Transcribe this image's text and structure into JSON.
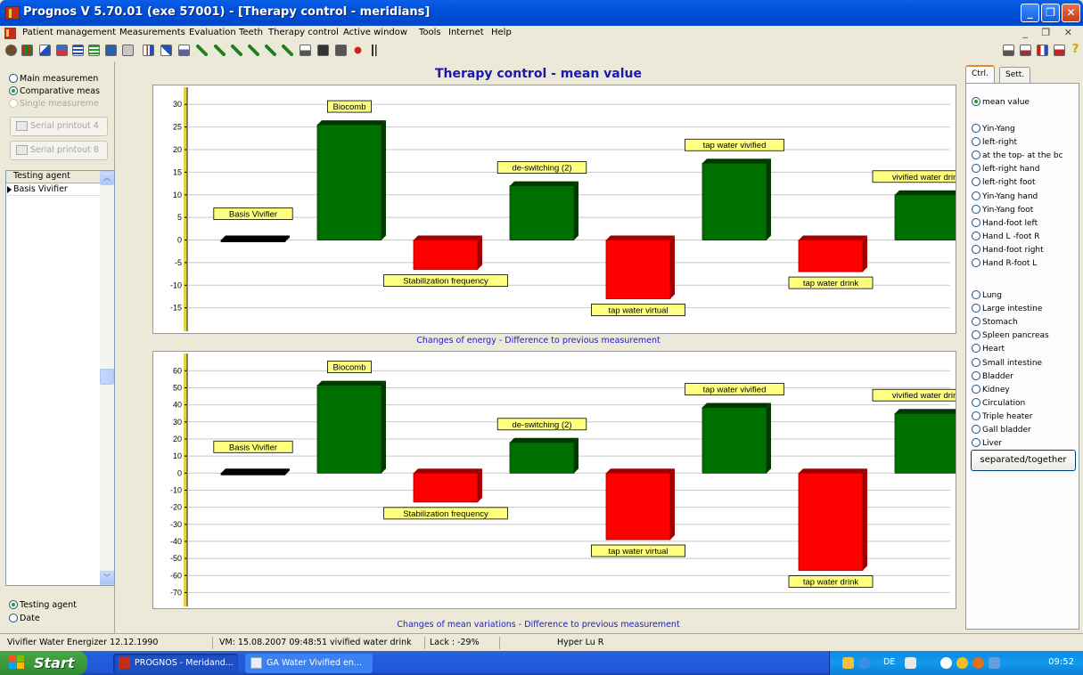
{
  "window": {
    "title": "Prognos V 5.70.01  (exe 57001) - [Therapy control - meridians]",
    "controls": [
      "minimize",
      "maximize",
      "close"
    ]
  },
  "menu": {
    "items": [
      "Patient management",
      "Measurements",
      "Evaluation",
      "Teeth",
      "Therapy control",
      "Active window",
      "Tools",
      "Internet",
      "Help"
    ]
  },
  "left_panel": {
    "view_options": [
      {
        "label": "Main measuremen",
        "selected": false,
        "enabled": true
      },
      {
        "label": "Comparative meas",
        "selected": true,
        "enabled": true
      },
      {
        "label": "Single measureme",
        "selected": false,
        "enabled": false
      }
    ],
    "buttons": [
      {
        "label": "Serial printout 4",
        "icon": "printer-icon",
        "enabled": false
      },
      {
        "label": "Serial printout 8",
        "icon": "printer-icon",
        "enabled": false
      }
    ],
    "list": {
      "header": "Testing agent",
      "rows": [
        "Basis Vivifier"
      ]
    },
    "sort_options": [
      {
        "label": "Testing agent",
        "selected": true
      },
      {
        "label": "Date",
        "selected": false
      }
    ]
  },
  "chart_panel": {
    "title": "Therapy control - mean value"
  },
  "chart_data": [
    {
      "type": "bar",
      "caption": "Changes of energy - Difference to previous measurement",
      "categories": [
        "Basis Vivifier",
        "Biocomb",
        "Stabilization frequency",
        "de-switching (2)",
        "tap water virtual",
        "tap water vivified",
        "tap water drink",
        "vivified water drink"
      ],
      "values": [
        0,
        25.5,
        -6.5,
        12,
        -13,
        17,
        -7,
        10
      ],
      "colors": [
        "#000000",
        "#007000",
        "#ff0000",
        "#007000",
        "#ff0000",
        "#007000",
        "#ff0000",
        "#007000"
      ],
      "yticks": [
        30,
        25,
        20,
        15,
        10,
        5,
        0,
        -5,
        -10,
        -15
      ],
      "ylim": [
        -19,
        33
      ],
      "grid": true,
      "legend": "none"
    },
    {
      "type": "bar",
      "caption": "Changes of mean variations - Difference to previous measurement",
      "categories": [
        "Basis Vivifier",
        "Biocomb",
        "Stabilization frequency",
        "de-switching (2)",
        "tap water virtual",
        "tap water vivified",
        "tap water drink",
        "vivified water drink"
      ],
      "values": [
        0,
        51.5,
        -17,
        18,
        -39,
        38.5,
        -57,
        35
      ],
      "colors": [
        "#000000",
        "#007000",
        "#ff0000",
        "#007000",
        "#ff0000",
        "#007000",
        "#ff0000",
        "#007000"
      ],
      "yticks": [
        60,
        50,
        40,
        30,
        20,
        10,
        0,
        -10,
        -20,
        -30,
        -40,
        -50,
        -60,
        -70
      ],
      "ylim": [
        -75,
        68
      ],
      "grid": true,
      "legend": "none"
    }
  ],
  "right_panel": {
    "tabs": [
      {
        "label": "Ctrl.",
        "active": true
      },
      {
        "label": "Sett.",
        "active": false
      }
    ],
    "mode_options": [
      {
        "label": "mean value",
        "selected": true
      }
    ],
    "comparison_options": [
      {
        "label": "Yin-Yang",
        "selected": false
      },
      {
        "label": "left-right",
        "selected": false
      },
      {
        "label": "at the top- at the bc",
        "selected": false
      },
      {
        "label": "left-right hand",
        "selected": false
      },
      {
        "label": "left-right foot",
        "selected": false
      },
      {
        "label": "Yin-Yang hand",
        "selected": false
      },
      {
        "label": "Yin-Yang foot",
        "selected": false
      },
      {
        "label": "Hand-foot left",
        "selected": false
      },
      {
        "label": "Hand L -foot R",
        "selected": false
      },
      {
        "label": "Hand-foot right",
        "selected": false
      },
      {
        "label": "Hand R-foot L",
        "selected": false
      }
    ],
    "meridian_options": [
      {
        "label": "Lung",
        "selected": false
      },
      {
        "label": "Large intestine",
        "selected": false
      },
      {
        "label": "Stomach",
        "selected": false
      },
      {
        "label": "Spleen pancreas",
        "selected": false
      },
      {
        "label": "Heart",
        "selected": false
      },
      {
        "label": "Small intestine",
        "selected": false
      },
      {
        "label": "Bladder",
        "selected": false
      },
      {
        "label": "Kidney",
        "selected": false
      },
      {
        "label": "Circulation",
        "selected": false
      },
      {
        "label": "Triple heater",
        "selected": false
      },
      {
        "label": "Gall bladder",
        "selected": false
      },
      {
        "label": "Liver",
        "selected": false
      }
    ],
    "separate_button": "separated/together"
  },
  "status_bar": {
    "fields": [
      "Vivifier Water Energizer 12.12.1990",
      "VM: 15.08.2007 09:48:51  vivified water drink",
      "Lack : -29%",
      "Hyper Lu R"
    ]
  },
  "taskbar": {
    "start_label": "Start",
    "tasks": [
      {
        "label": "PROGNOS - Meridand...",
        "active": true
      },
      {
        "label": "GA Water Vivified en...",
        "active": false
      }
    ],
    "language": "DE",
    "clock": "09:52"
  }
}
